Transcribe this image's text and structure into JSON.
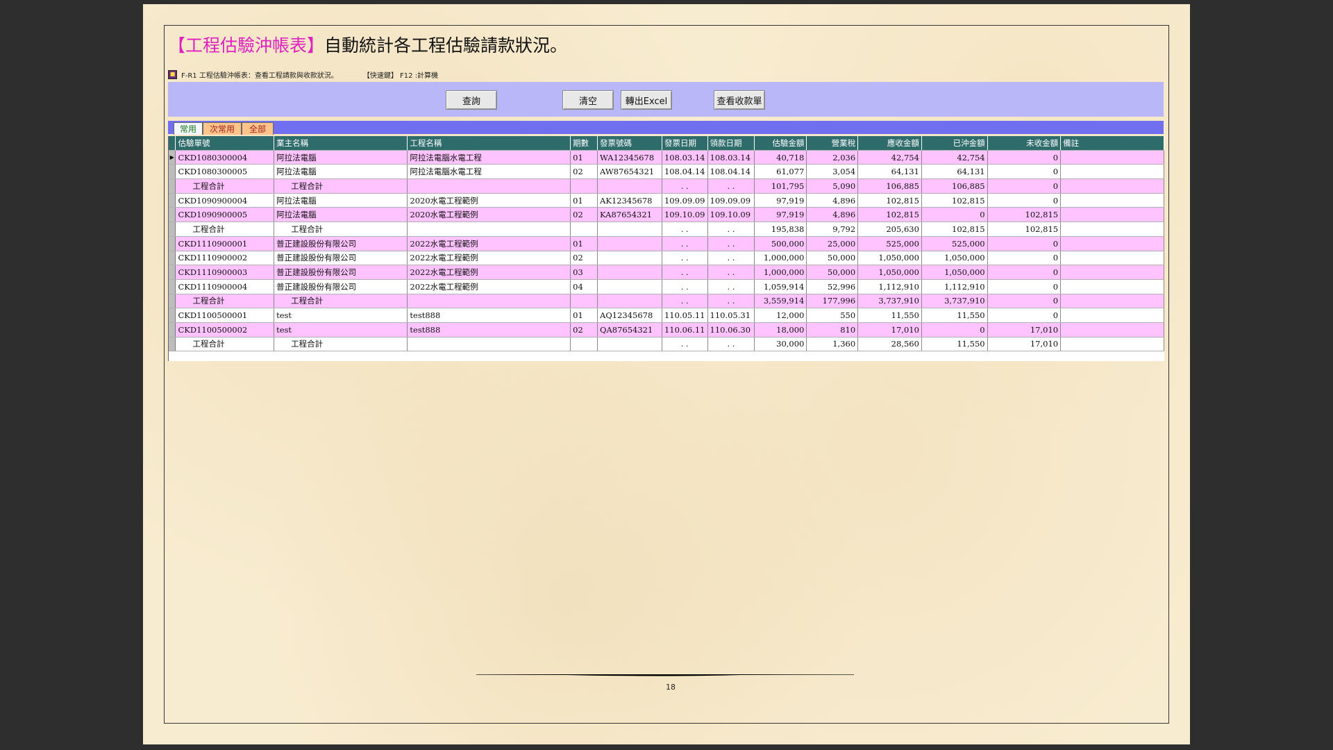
{
  "headline": {
    "highlight": "【工程估驗沖帳表】",
    "rest": "自動統計各工程估驗請款狀況。"
  },
  "app": {
    "title": "F-R1 工程估驗沖帳表：查看工程請款與收款狀況。",
    "shortcut": "【快速鍵】 F12 :計算機"
  },
  "toolbar": {
    "query": "查詢",
    "clear": "清空",
    "export": "轉出Excel",
    "receipts": "查看收款單"
  },
  "tabs": [
    "常用",
    "次常用",
    "全部"
  ],
  "columns": [
    "估驗單號",
    "業主名稱",
    "工程名稱",
    "期數",
    "發票號碼",
    "發票日期",
    "領款日期",
    "估驗金額",
    "營業稅",
    "應收金額",
    "已沖金額",
    "未收金額",
    "備註"
  ],
  "rows": [
    [
      "CKD1080300004",
      "阿拉法電腦",
      "阿拉法電腦水電工程",
      "01",
      "WA12345678",
      "108.03.14",
      "108.03.14",
      "40,718",
      "2,036",
      "42,754",
      "42,754",
      "0",
      ""
    ],
    [
      "CKD1080300005",
      "阿拉法電腦",
      "阿拉法電腦水電工程",
      "02",
      "AW87654321",
      "108.04.14",
      "108.04.14",
      "61,077",
      "3,054",
      "64,131",
      "64,131",
      "0",
      ""
    ],
    [
      "工程合計",
      "工程合計",
      "",
      "",
      "",
      ". .",
      ". .",
      "101,795",
      "5,090",
      "106,885",
      "106,885",
      "0",
      ""
    ],
    [
      "CKD1090900004",
      "阿拉法電腦",
      "2020水電工程範例",
      "01",
      "AK12345678",
      "109.09.09",
      "109.09.09",
      "97,919",
      "4,896",
      "102,815",
      "102,815",
      "0",
      ""
    ],
    [
      "CKD1090900005",
      "阿拉法電腦",
      "2020水電工程範例",
      "02",
      "KA87654321",
      "109.10.09",
      "109.10.09",
      "97,919",
      "4,896",
      "102,815",
      "0",
      "102,815",
      ""
    ],
    [
      "工程合計",
      "工程合計",
      "",
      "",
      "",
      ". .",
      ". .",
      "195,838",
      "9,792",
      "205,630",
      "102,815",
      "102,815",
      ""
    ],
    [
      "CKD1110900001",
      "普正建設股份有限公司",
      "2022水電工程範例",
      "01",
      "",
      ". .",
      ". .",
      "500,000",
      "25,000",
      "525,000",
      "525,000",
      "0",
      ""
    ],
    [
      "CKD1110900002",
      "普正建設股份有限公司",
      "2022水電工程範例",
      "02",
      "",
      ". .",
      ". .",
      "1,000,000",
      "50,000",
      "1,050,000",
      "1,050,000",
      "0",
      ""
    ],
    [
      "CKD1110900003",
      "普正建設股份有限公司",
      "2022水電工程範例",
      "03",
      "",
      ". .",
      ". .",
      "1,000,000",
      "50,000",
      "1,050,000",
      "1,050,000",
      "0",
      ""
    ],
    [
      "CKD1110900004",
      "普正建設股份有限公司",
      "2022水電工程範例",
      "04",
      "",
      ". .",
      ". .",
      "1,059,914",
      "52,996",
      "1,112,910",
      "1,112,910",
      "0",
      ""
    ],
    [
      "工程合計",
      "工程合計",
      "",
      "",
      "",
      ". .",
      ". .",
      "3,559,914",
      "177,996",
      "3,737,910",
      "3,737,910",
      "0",
      ""
    ],
    [
      "CKD1100500001",
      "test",
      "test888",
      "01",
      "AQ12345678",
      "110.05.11",
      "110.05.31",
      "12,000",
      "550",
      "11,550",
      "11,550",
      "0",
      ""
    ],
    [
      "CKD1100500002",
      "test",
      "test888",
      "02",
      "QA87654321",
      "110.06.11",
      "110.06.30",
      "18,000",
      "810",
      "17,010",
      "0",
      "17,010",
      ""
    ],
    [
      "工程合計",
      "工程合計",
      "",
      "",
      "",
      ". .",
      ". .",
      "30,000",
      "1,360",
      "28,560",
      "11,550",
      "17,010",
      ""
    ]
  ],
  "row_colors": [
    "pink",
    "white",
    "pink",
    "white",
    "pink",
    "white",
    "pink",
    "white",
    "pink",
    "white",
    "pink",
    "white",
    "pink",
    "white"
  ],
  "subtotal_rows": [
    2,
    5,
    10,
    13
  ],
  "selected_row": 0,
  "selector_glyph": "▶",
  "page_number": "18",
  "colors": {
    "highlight": "#e020c0",
    "toolbar": "#b8b8f8",
    "tabbar": "#6f6ff0",
    "header": "#2e6b6b",
    "row_pink": "#ffc4ff"
  }
}
